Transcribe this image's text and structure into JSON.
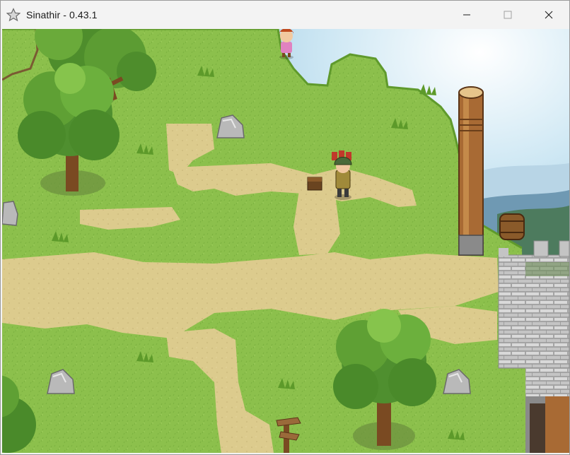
{
  "window": {
    "title": "Sinathir - 0.43.1",
    "app_icon": "star-icon",
    "controls": [
      "minimize-icon",
      "maximize-icon",
      "close-icon"
    ]
  },
  "scene": {
    "type": "top-down-rpg-map",
    "colors": {
      "grass": "#8cc04c",
      "grass_dark": "#6fa23a",
      "path": "#d9c98c",
      "sky": "#bfe0f0",
      "tree": "#4f8f2f",
      "trunk": "#7a4a22",
      "stone_wall": "#c8c8c8"
    }
  }
}
